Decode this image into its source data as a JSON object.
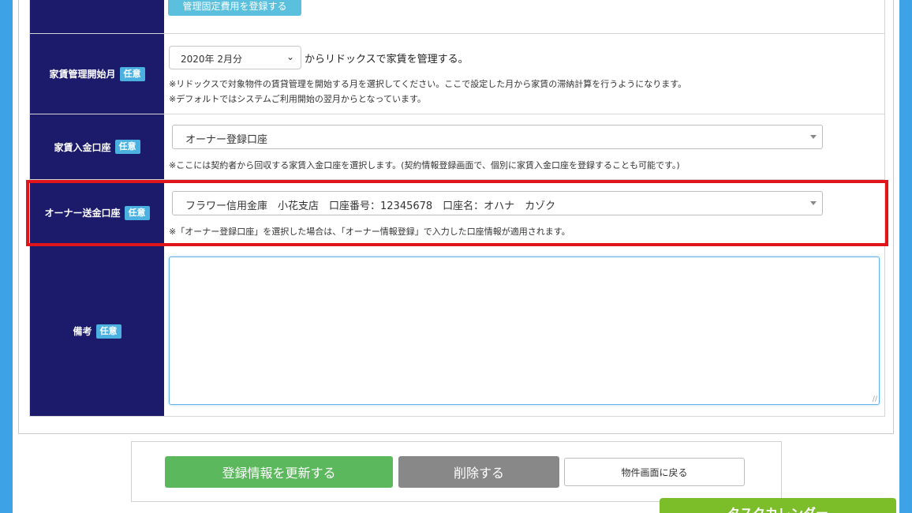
{
  "top_button": {
    "label": "管理固定費用を登録する"
  },
  "badge_optional": "任意",
  "rows": {
    "rent_start": {
      "label": "家賃管理開始月",
      "select_value": "2020年 2月分",
      "after_text": "からリドックスで家賃を管理する。",
      "note1": "※リドックスで対象物件の賃貸管理を開始する月を選択してください。ここで設定した月から家賃の滞納計算を行うようになります。",
      "note2": "※デフォルトではシステムご利用開始の翌月からとなっています。"
    },
    "rent_account": {
      "label": "家賃入金口座",
      "select_value": "オーナー登録口座",
      "note": "※ここには契約者から回収する家賃入金口座を選択します。(契約情報登録画面で、個別に家賃入金口座を登録することも可能です。)"
    },
    "owner_account": {
      "label": "オーナー送金口座",
      "select_value": "フラワー信用金庫　小花支店　口座番号：12345678　口座名：オハナ　カゾク",
      "note": "※「オーナー登録口座」を選択した場合は、「オーナー情報登録」で入力した口座情報が適用されます。"
    },
    "remarks": {
      "label": "備考",
      "value": ""
    }
  },
  "actions": {
    "update": "登録情報を更新する",
    "delete": "削除する",
    "back": "物件画面に戻る"
  },
  "task_calendar": "タスクカレンダー",
  "colors": {
    "header_bg": "#1b1a6b",
    "badge": "#4ab1e0",
    "update": "#5cb85c",
    "delete": "#888888",
    "highlight": "#e0151c",
    "background": "#3ea3e6"
  }
}
